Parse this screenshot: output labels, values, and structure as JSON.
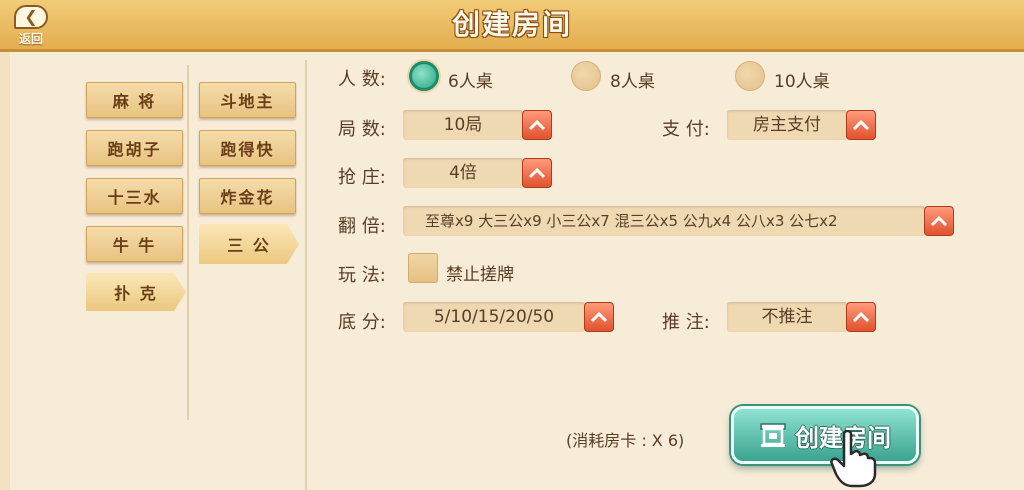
{
  "header": {
    "back_label": "返回",
    "title": "创建房间"
  },
  "categories": {
    "col1": [
      "麻 将",
      "跑胡子",
      "十三水",
      "牛 牛",
      "扑 克"
    ],
    "col2": [
      "斗地主",
      "跑得快",
      "炸金花",
      "三 公"
    ]
  },
  "form": {
    "players": {
      "label": "人  数:",
      "options": [
        "6人桌",
        "8人桌",
        "10人桌"
      ],
      "selected": "6人桌"
    },
    "rounds": {
      "label": "局  数:",
      "value": "10局"
    },
    "payment": {
      "label": "支  付:",
      "value": "房主支付"
    },
    "banker": {
      "label": "抢  庄:",
      "value": "4倍"
    },
    "multiplier": {
      "label": "翻  倍:",
      "value": "至尊x9 大三公x9 小三公x7 混三公x5 公九x4 公八x3 公七x2"
    },
    "rules": {
      "label": "玩  法:",
      "option": "禁止搓牌",
      "checked": false
    },
    "base_score": {
      "label": "底  分:",
      "value": "5/10/15/20/50"
    },
    "bet_push": {
      "label": "推  注:",
      "value": "不推注"
    }
  },
  "footer": {
    "cost": "(消耗房卡 : X 6)",
    "create_label": "创建房间"
  },
  "colors": {
    "accent_teal": "#3aa38e",
    "arrow_red": "#e0522e",
    "header_gold": "#e3ae4f"
  }
}
